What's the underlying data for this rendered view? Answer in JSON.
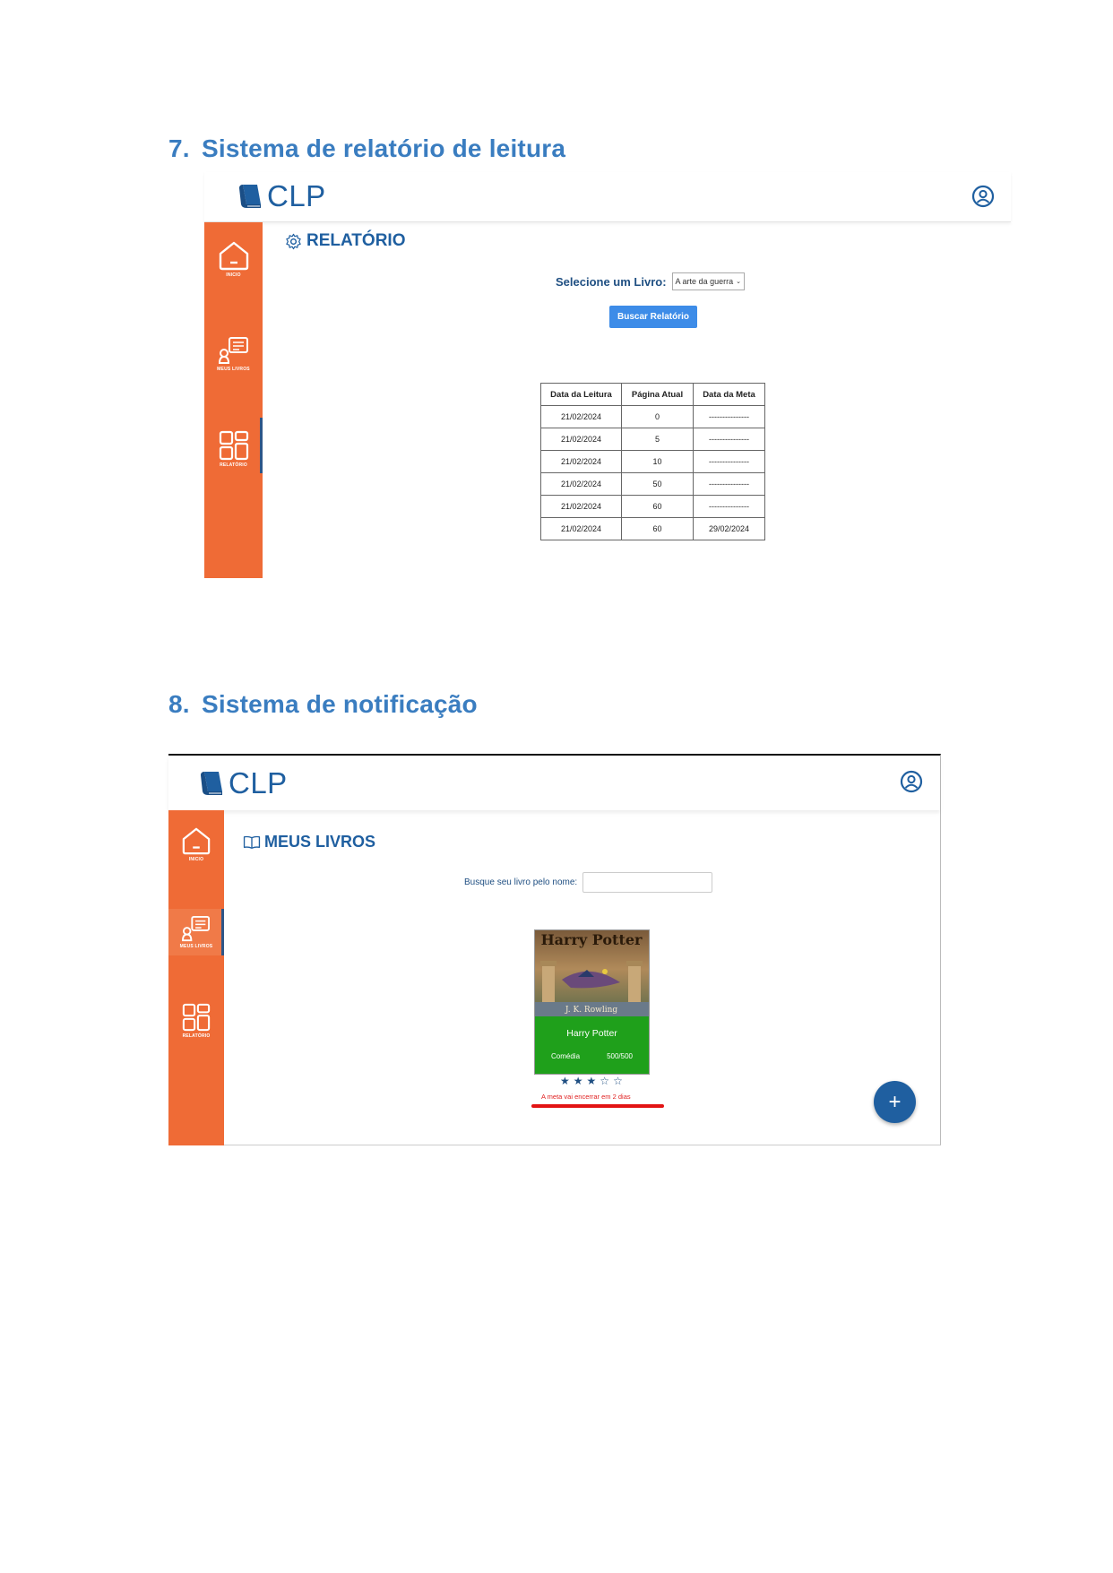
{
  "doc": {
    "section7": {
      "number": "7.",
      "title": "Sistema de relatório de leitura"
    },
    "section8": {
      "number": "8.",
      "title": "Sistema de notificação"
    }
  },
  "app": {
    "logo_text": "CLP"
  },
  "nav": {
    "inicio": "INICIO",
    "meus_livros": "MEUS LIVROS",
    "relatorio": "RELATÓRIO"
  },
  "report": {
    "title": "RELATÓRIO",
    "select_label": "Selecione um Livro:",
    "selected_book": "A arte da guerra",
    "button_label": "Buscar Relatório",
    "table": {
      "headers": [
        "Data da Leitura",
        "Página Atual",
        "Data da Meta"
      ],
      "rows": [
        [
          "21/02/2024",
          "0",
          "---------------"
        ],
        [
          "21/02/2024",
          "5",
          "---------------"
        ],
        [
          "21/02/2024",
          "10",
          "---------------"
        ],
        [
          "21/02/2024",
          "50",
          "---------------"
        ],
        [
          "21/02/2024",
          "60",
          "---------------"
        ],
        [
          "21/02/2024",
          "60",
          "29/02/2024"
        ]
      ]
    }
  },
  "books": {
    "title": "MEUS LIVROS",
    "search_label": "Busque seu livro pelo nome:",
    "search_value": "",
    "card": {
      "cover_title": "Harry Potter",
      "cover_author": "J. K. Rowling",
      "name": "Harry Potter",
      "genre": "Comédia",
      "progress": "500/500",
      "rating": 3,
      "rating_max": 5
    },
    "notification": "A meta vai encerrar em 2 dias",
    "fab_label": "+"
  },
  "colors": {
    "accent": "#1f5fa0",
    "sidebar": "#ef6b36",
    "card": "#1fa01b",
    "alert": "#e21414",
    "heading": "#3a7dc0"
  }
}
